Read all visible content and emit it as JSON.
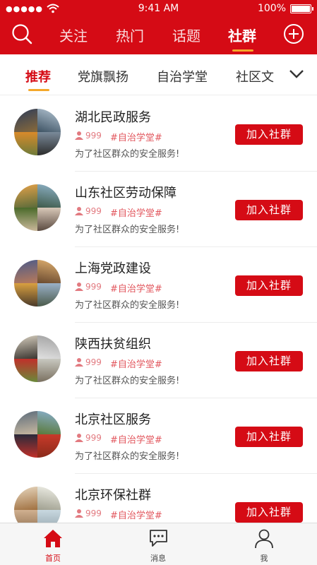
{
  "status_bar": {
    "signal": "●●●●●",
    "time": "9:41 AM",
    "battery": "100%"
  },
  "nav": {
    "tabs": [
      {
        "label": "关注"
      },
      {
        "label": "热门"
      },
      {
        "label": "话题"
      },
      {
        "label": "社群"
      }
    ],
    "active_tab": "社群"
  },
  "subtabs": [
    {
      "label": "推荐"
    },
    {
      "label": "党旗飘扬"
    },
    {
      "label": "自治学堂"
    },
    {
      "label": "社区文"
    }
  ],
  "groups": [
    {
      "name": "湖北民政服务",
      "members": "999",
      "tag": "#自治学堂#",
      "desc": "为了社区群众的安全服务!",
      "join": "加入社群"
    },
    {
      "name": "山东社区劳动保障",
      "members": "999",
      "tag": "#自治学堂#",
      "desc": "为了社区群众的安全服务!",
      "join": "加入社群"
    },
    {
      "name": "上海党政建设",
      "members": "999",
      "tag": "#自治学堂#",
      "desc": "为了社区群众的安全服务!",
      "join": "加入社群"
    },
    {
      "name": "陕西扶贫组织",
      "members": "999",
      "tag": "#自治学堂#",
      "desc": "为了社区群众的安全服务!",
      "join": "加入社群"
    },
    {
      "name": "北京社区服务",
      "members": "999",
      "tag": "#自治学堂#",
      "desc": "为了社区群众的安全服务!",
      "join": "加入社群"
    },
    {
      "name": "北京环保社群",
      "members": "999",
      "tag": "#自治学堂#",
      "desc": "",
      "join": "加入社群"
    }
  ],
  "tabbar": [
    {
      "label": "首页",
      "icon": "home-icon"
    },
    {
      "label": "消息",
      "icon": "message-icon"
    },
    {
      "label": "我",
      "icon": "profile-icon"
    }
  ],
  "colors": {
    "brand": "#d50b15",
    "accent": "#f4a82a",
    "tag": "#e2575e"
  }
}
